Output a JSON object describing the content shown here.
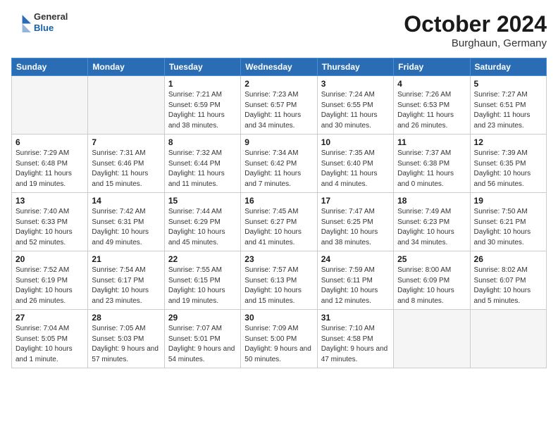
{
  "header": {
    "logo": {
      "general": "General",
      "blue": "Blue"
    },
    "month_title": "October 2024",
    "location": "Burghaun, Germany"
  },
  "weekdays": [
    "Sunday",
    "Monday",
    "Tuesday",
    "Wednesday",
    "Thursday",
    "Friday",
    "Saturday"
  ],
  "weeks": [
    [
      {
        "day": "",
        "info": ""
      },
      {
        "day": "",
        "info": ""
      },
      {
        "day": "1",
        "info": "Sunrise: 7:21 AM\nSunset: 6:59 PM\nDaylight: 11 hours and 38 minutes."
      },
      {
        "day": "2",
        "info": "Sunrise: 7:23 AM\nSunset: 6:57 PM\nDaylight: 11 hours and 34 minutes."
      },
      {
        "day": "3",
        "info": "Sunrise: 7:24 AM\nSunset: 6:55 PM\nDaylight: 11 hours and 30 minutes."
      },
      {
        "day": "4",
        "info": "Sunrise: 7:26 AM\nSunset: 6:53 PM\nDaylight: 11 hours and 26 minutes."
      },
      {
        "day": "5",
        "info": "Sunrise: 7:27 AM\nSunset: 6:51 PM\nDaylight: 11 hours and 23 minutes."
      }
    ],
    [
      {
        "day": "6",
        "info": "Sunrise: 7:29 AM\nSunset: 6:48 PM\nDaylight: 11 hours and 19 minutes."
      },
      {
        "day": "7",
        "info": "Sunrise: 7:31 AM\nSunset: 6:46 PM\nDaylight: 11 hours and 15 minutes."
      },
      {
        "day": "8",
        "info": "Sunrise: 7:32 AM\nSunset: 6:44 PM\nDaylight: 11 hours and 11 minutes."
      },
      {
        "day": "9",
        "info": "Sunrise: 7:34 AM\nSunset: 6:42 PM\nDaylight: 11 hours and 7 minutes."
      },
      {
        "day": "10",
        "info": "Sunrise: 7:35 AM\nSunset: 6:40 PM\nDaylight: 11 hours and 4 minutes."
      },
      {
        "day": "11",
        "info": "Sunrise: 7:37 AM\nSunset: 6:38 PM\nDaylight: 11 hours and 0 minutes."
      },
      {
        "day": "12",
        "info": "Sunrise: 7:39 AM\nSunset: 6:35 PM\nDaylight: 10 hours and 56 minutes."
      }
    ],
    [
      {
        "day": "13",
        "info": "Sunrise: 7:40 AM\nSunset: 6:33 PM\nDaylight: 10 hours and 52 minutes."
      },
      {
        "day": "14",
        "info": "Sunrise: 7:42 AM\nSunset: 6:31 PM\nDaylight: 10 hours and 49 minutes."
      },
      {
        "day": "15",
        "info": "Sunrise: 7:44 AM\nSunset: 6:29 PM\nDaylight: 10 hours and 45 minutes."
      },
      {
        "day": "16",
        "info": "Sunrise: 7:45 AM\nSunset: 6:27 PM\nDaylight: 10 hours and 41 minutes."
      },
      {
        "day": "17",
        "info": "Sunrise: 7:47 AM\nSunset: 6:25 PM\nDaylight: 10 hours and 38 minutes."
      },
      {
        "day": "18",
        "info": "Sunrise: 7:49 AM\nSunset: 6:23 PM\nDaylight: 10 hours and 34 minutes."
      },
      {
        "day": "19",
        "info": "Sunrise: 7:50 AM\nSunset: 6:21 PM\nDaylight: 10 hours and 30 minutes."
      }
    ],
    [
      {
        "day": "20",
        "info": "Sunrise: 7:52 AM\nSunset: 6:19 PM\nDaylight: 10 hours and 26 minutes."
      },
      {
        "day": "21",
        "info": "Sunrise: 7:54 AM\nSunset: 6:17 PM\nDaylight: 10 hours and 23 minutes."
      },
      {
        "day": "22",
        "info": "Sunrise: 7:55 AM\nSunset: 6:15 PM\nDaylight: 10 hours and 19 minutes."
      },
      {
        "day": "23",
        "info": "Sunrise: 7:57 AM\nSunset: 6:13 PM\nDaylight: 10 hours and 15 minutes."
      },
      {
        "day": "24",
        "info": "Sunrise: 7:59 AM\nSunset: 6:11 PM\nDaylight: 10 hours and 12 minutes."
      },
      {
        "day": "25",
        "info": "Sunrise: 8:00 AM\nSunset: 6:09 PM\nDaylight: 10 hours and 8 minutes."
      },
      {
        "day": "26",
        "info": "Sunrise: 8:02 AM\nSunset: 6:07 PM\nDaylight: 10 hours and 5 minutes."
      }
    ],
    [
      {
        "day": "27",
        "info": "Sunrise: 7:04 AM\nSunset: 5:05 PM\nDaylight: 10 hours and 1 minute."
      },
      {
        "day": "28",
        "info": "Sunrise: 7:05 AM\nSunset: 5:03 PM\nDaylight: 9 hours and 57 minutes."
      },
      {
        "day": "29",
        "info": "Sunrise: 7:07 AM\nSunset: 5:01 PM\nDaylight: 9 hours and 54 minutes."
      },
      {
        "day": "30",
        "info": "Sunrise: 7:09 AM\nSunset: 5:00 PM\nDaylight: 9 hours and 50 minutes."
      },
      {
        "day": "31",
        "info": "Sunrise: 7:10 AM\nSunset: 4:58 PM\nDaylight: 9 hours and 47 minutes."
      },
      {
        "day": "",
        "info": ""
      },
      {
        "day": "",
        "info": ""
      }
    ]
  ]
}
